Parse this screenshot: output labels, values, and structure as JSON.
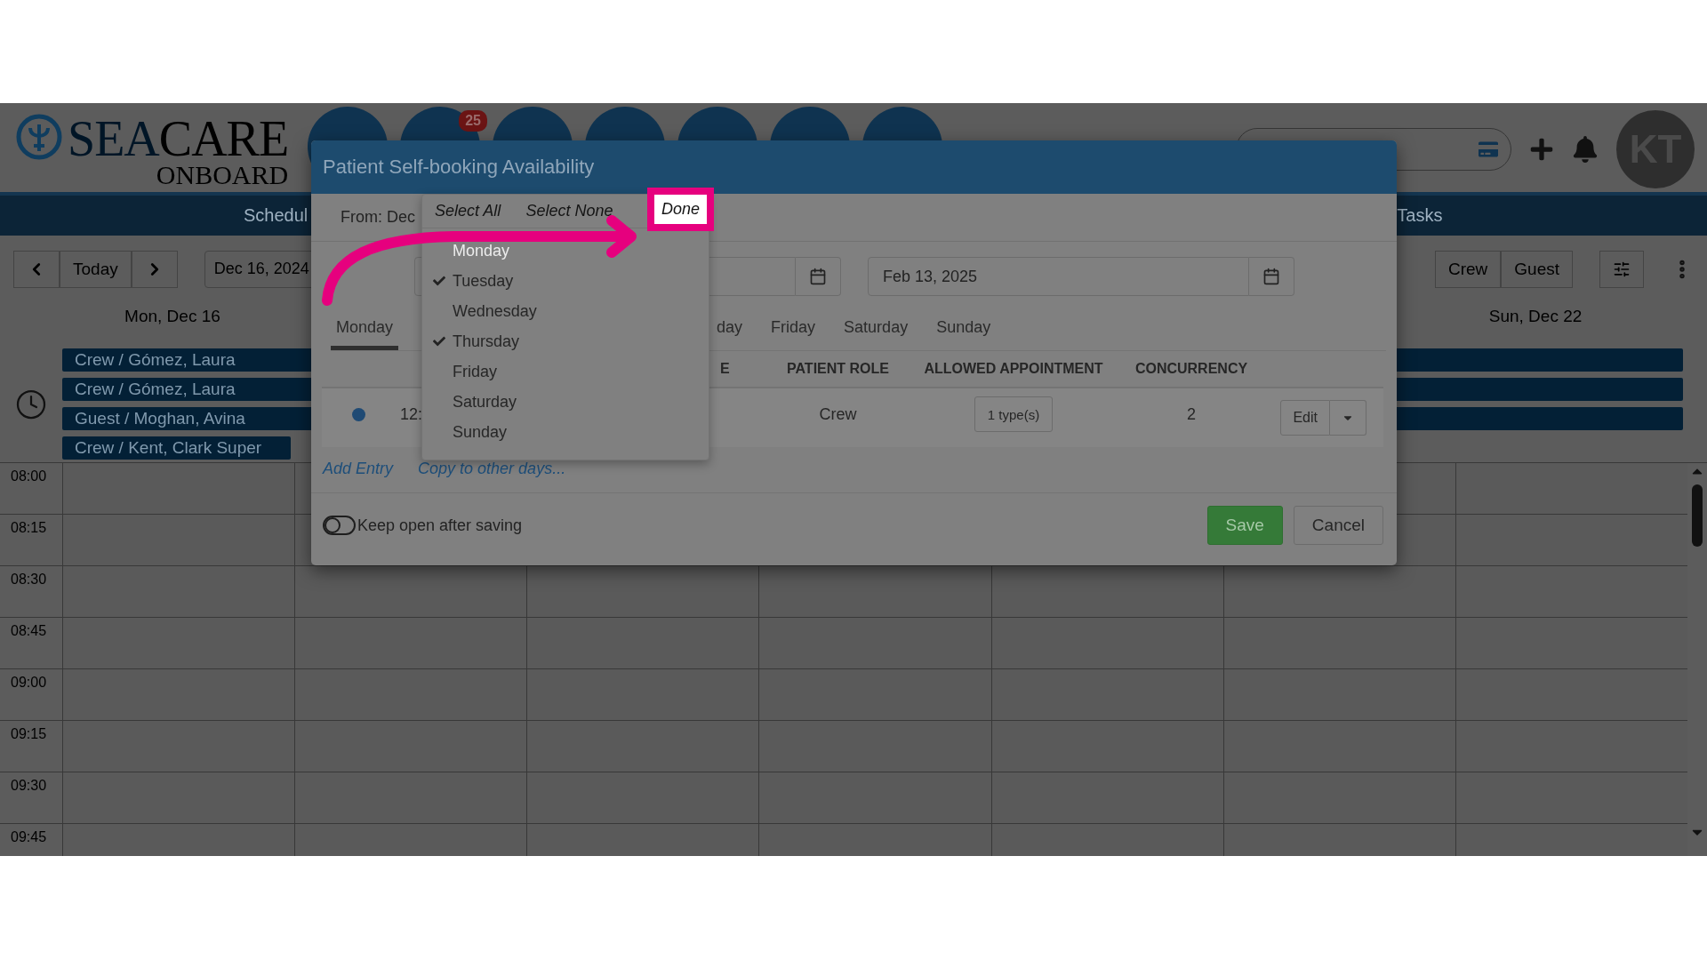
{
  "header": {
    "logo": {
      "first": "SEA",
      "second": "CARE",
      "sub": "ONBOARD"
    },
    "badge": "25",
    "avatar": "KT"
  },
  "nav": [
    "Schedul",
    "Tasks"
  ],
  "toolbar": {
    "today": "Today",
    "date": "Dec 16, 2024",
    "filters": [
      "Crew",
      "Guest"
    ]
  },
  "calendar": {
    "days": [
      "Mon, Dec 16",
      "Sun, Dec 22"
    ],
    "events": [
      {
        "label": "Crew / Gómez, Laura",
        "continues": true
      },
      {
        "label": "Crew / Gómez, Laura",
        "continues": true
      },
      {
        "label": "Guest / Moghan, Avina",
        "continues": true
      },
      {
        "label": "Crew / Kent, Clark Super",
        "continues": false
      }
    ],
    "times": [
      "08:00",
      "08:15",
      "08:30",
      "08:45",
      "09:00",
      "09:15",
      "09:30",
      "09:45"
    ]
  },
  "modal": {
    "title": "Patient Self-booking Availability",
    "from_label": "From: Dec",
    "end_date": "Feb 13, 2025",
    "tabs": [
      {
        "label": "Monday",
        "selected": true
      },
      {
        "label": "day",
        "selected": false
      },
      {
        "label": "Friday",
        "selected": false
      },
      {
        "label": "Saturday",
        "selected": false
      },
      {
        "label": "Sunday",
        "selected": false
      }
    ],
    "columns": [
      "E",
      "PATIENT ROLE",
      "ALLOWED APPOINTMENT",
      "CONCURRENCY"
    ],
    "rows": [
      {
        "time": "12:",
        "role": "Crew",
        "types": "1 type(s)",
        "concurrency": "2",
        "action": "Edit"
      }
    ],
    "links": [
      "Add Entry",
      "Copy to other days..."
    ],
    "keep_open": {
      "label": "Keep open after saving",
      "on": false
    },
    "buttons": [
      {
        "label": "Save",
        "kind": "primary"
      },
      {
        "label": "Cancel",
        "kind": "default"
      }
    ]
  },
  "day_menu": {
    "actions": [
      {
        "label": "Select All",
        "highlighted": false
      },
      {
        "label": "Select None",
        "highlighted": false
      },
      {
        "label": "Done",
        "highlighted": true
      }
    ],
    "items": [
      {
        "label": "Monday",
        "checked": false,
        "disabled": true
      },
      {
        "label": "Tuesday",
        "checked": true,
        "disabled": false
      },
      {
        "label": "Wednesday",
        "checked": false,
        "disabled": false
      },
      {
        "label": "Thursday",
        "checked": true,
        "disabled": false
      },
      {
        "label": "Friday",
        "checked": false,
        "disabled": false
      },
      {
        "label": "Saturday",
        "checked": false,
        "disabled": false
      },
      {
        "label": "Sunday",
        "checked": false,
        "disabled": false
      }
    ]
  }
}
